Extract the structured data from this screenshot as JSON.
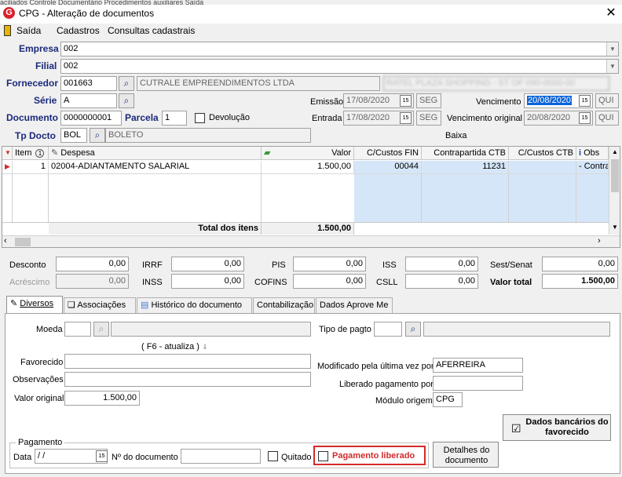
{
  "window": {
    "title": "CPG - Alteração de documentos",
    "logo_letter": "G",
    "top_strip": "aciliados    Controle Documentário    Procedimentos auxiliares    Saída"
  },
  "menu": {
    "items": [
      "Saída",
      "Cadastros",
      "Consultas cadastrais"
    ]
  },
  "header": {
    "empresa": {
      "label": "Empresa",
      "value": "002"
    },
    "filial": {
      "label": "Filial",
      "value": "002"
    },
    "fornecedor": {
      "label": "Fornecedor",
      "code": "001663",
      "name": "CUTRALE EMPREENDIMENTOS LTDA",
      "extra": "RATEL PLAZA SHOPPING - ST OF 090-0000-00"
    },
    "serie": {
      "label": "Série",
      "value": "A"
    },
    "documento": {
      "label": "Documento",
      "value": "0000000001"
    },
    "parcela": {
      "label": "Parcela",
      "value": "1"
    },
    "devolucao": {
      "label": "Devolução"
    },
    "tp_docto": {
      "label": "Tp Docto",
      "code": "BOL",
      "name": "BOLETO"
    },
    "emissao": {
      "label": "Emissão",
      "date": "17/08/2020",
      "weekday": "SEG"
    },
    "entrada": {
      "label": "Entrada",
      "date": "17/08/2020",
      "weekday": "SEG"
    },
    "vencimento": {
      "label": "Vencimento",
      "date": "20/08/2020",
      "weekday": "QUI"
    },
    "vencimento_original": {
      "label": "Vencimento original",
      "date": "20/08/2020",
      "weekday": "QUI"
    },
    "baixa_label": "Baixa"
  },
  "grid": {
    "columns": {
      "item": "Item",
      "item_sort": "1",
      "despesa": "Despesa",
      "valor": "Valor",
      "cc_fin": "C/Custos FIN",
      "contrapartida": "Contrapartida CTB",
      "cc_ctb": "C/Custos CTB",
      "obs": "Obs"
    },
    "rows": [
      {
        "item": "1",
        "despesa": "02004-ADIANTAMENTO SALARIAL",
        "valor": "1.500,00",
        "cc_fin": "00044",
        "contrapartida": "11231",
        "cc_ctb": "",
        "obs": "- Contra"
      }
    ],
    "total_label": "Total dos itens",
    "total_value": "1.500,00"
  },
  "taxes": {
    "desconto": {
      "label": "Desconto",
      "value": "0,00"
    },
    "acrescimo": {
      "label": "Acréscimo",
      "value": "0,00"
    },
    "irrf": {
      "label": "IRRF",
      "value": "0,00"
    },
    "inss": {
      "label": "INSS",
      "value": "0,00"
    },
    "pis": {
      "label": "PIS",
      "value": "0,00"
    },
    "cofins": {
      "label": "COFINS",
      "value": "0,00"
    },
    "iss": {
      "label": "ISS",
      "value": "0,00"
    },
    "csll": {
      "label": "CSLL",
      "value": "0,00"
    },
    "sest_senat": {
      "label": "Sest/Senat",
      "value": "0,00"
    },
    "valor_total": {
      "label": "Valor total",
      "value": "1.500,00"
    }
  },
  "tabs": [
    "Diversos",
    "Associações",
    "Histórico do documento",
    "Contabilização",
    "Dados Aprove Me"
  ],
  "diversos": {
    "moeda_label": "Moeda",
    "f6_hint": "( F6 - atualiza )",
    "favorecido_label": "Favorecido",
    "observacoes_label": "Observações",
    "valor_original": {
      "label": "Valor original",
      "value": "1.500,00"
    },
    "tipo_pagto_label": "Tipo de pagto",
    "modificado": {
      "label": "Modificado pela última vez por",
      "value": "AFERREIRA"
    },
    "liberado_label": "Liberado pagamento por",
    "modulo": {
      "label": "Módulo origem",
      "value": "CPG"
    },
    "dados_bancarios_label": "Dados bancários do favorecido",
    "pagamento": {
      "group_label": "Pagamento",
      "data_label": "Data",
      "data_value": " /  /",
      "ndoc_label": "Nº do documento",
      "quitado_label": "Quitado",
      "liberado_label": "Pagamento liberado"
    },
    "detalhes_label": "Detalhes do documento"
  },
  "colors": {
    "label_blue": "#1a2a7a",
    "highlight": "#0a64d8",
    "pag_liberado": "#d42a2a",
    "row_select": "#d5e6f8"
  }
}
